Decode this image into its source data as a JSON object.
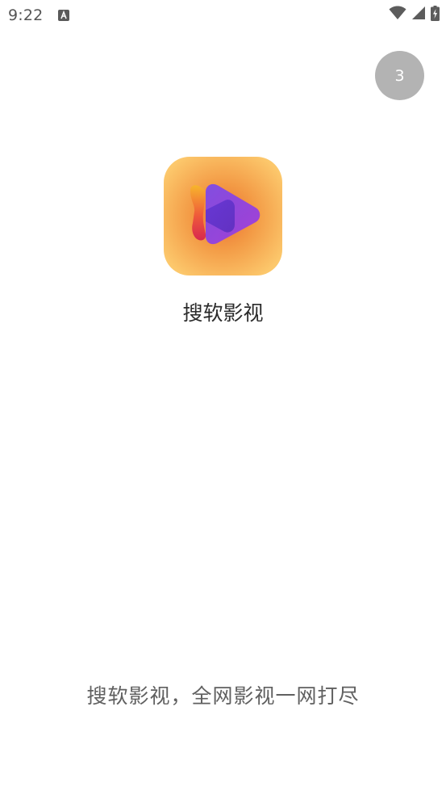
{
  "status_bar": {
    "time": "9:22",
    "notification_icon": "a-letter-icon",
    "icons": [
      "wifi-icon",
      "signal-icon",
      "battery-charging-icon"
    ]
  },
  "splash": {
    "countdown": "3",
    "app_name": "搜软影视",
    "slogan": "搜软影视，全网影视一网打尽"
  },
  "colors": {
    "icon_bg_center": "#f08a3e",
    "icon_bg_edge": "#fbc46a",
    "play_purple": "#8b35e0",
    "countdown_bg": "#b3b3b3"
  }
}
